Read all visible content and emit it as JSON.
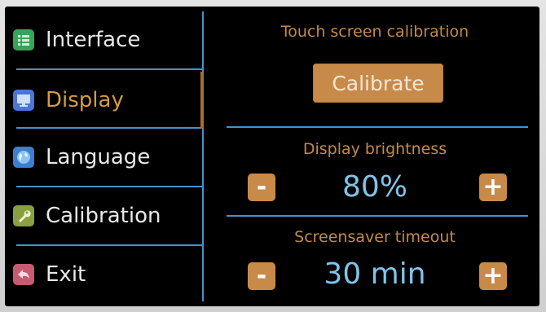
{
  "nav": {
    "items": [
      {
        "label": "Interface",
        "icon": "list-icon",
        "color": "#3aa35a"
      },
      {
        "label": "Display",
        "icon": "monitor-icon",
        "color": "#4d74d8"
      },
      {
        "label": "Language",
        "icon": "globe-icon",
        "color": "#3b7fd0"
      },
      {
        "label": "Calibration",
        "icon": "wrench-icon",
        "color": "#8aa040"
      },
      {
        "label": "Exit",
        "icon": "exit-arrow-icon",
        "color": "#c85a72"
      }
    ],
    "active_index": 1
  },
  "calibration": {
    "title": "Touch screen calibration",
    "button_label": "Calibrate"
  },
  "brightness": {
    "title": "Display brightness",
    "value": "80%",
    "minus": "-",
    "plus": "+"
  },
  "screensaver": {
    "title": "Screensaver timeout",
    "value": "30 min",
    "minus": "-",
    "plus": "+"
  },
  "colors": {
    "accent": "#c88a48",
    "divider": "#4a90c8",
    "value_text": "#7ec4ea"
  }
}
